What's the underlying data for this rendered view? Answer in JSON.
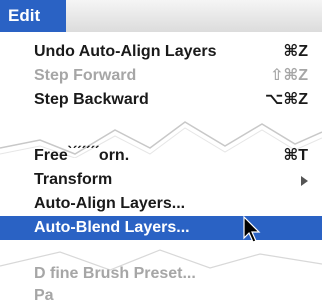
{
  "menubar": {
    "title": "Edit"
  },
  "menu": {
    "items": [
      {
        "label": "Undo Auto-Align Layers",
        "shortcut": "⌘Z"
      },
      {
        "label": "Step Forward",
        "shortcut": "⇧⌘Z"
      },
      {
        "label": "Step Backward",
        "shortcut": "⌥⌘Z"
      },
      {
        "label": "Free ̀ ́ ́ ́ ́ ́ ́orn.",
        "shortcut": "⌘T"
      },
      {
        "label": "Transform"
      },
      {
        "label": "Auto-Align Layers..."
      },
      {
        "label": "Auto-Blend Layers..."
      },
      {
        "label": "D fine Brush Preset..."
      },
      {
        "label": "  Pa"
      }
    ]
  },
  "colors": {
    "highlight": "#2a62c4",
    "disabled_text": "#a6a6a6",
    "text": "#1a1a1a"
  },
  "icons": {
    "submenu": "chevron-right-icon",
    "cursor": "arrow-pointer-icon"
  }
}
